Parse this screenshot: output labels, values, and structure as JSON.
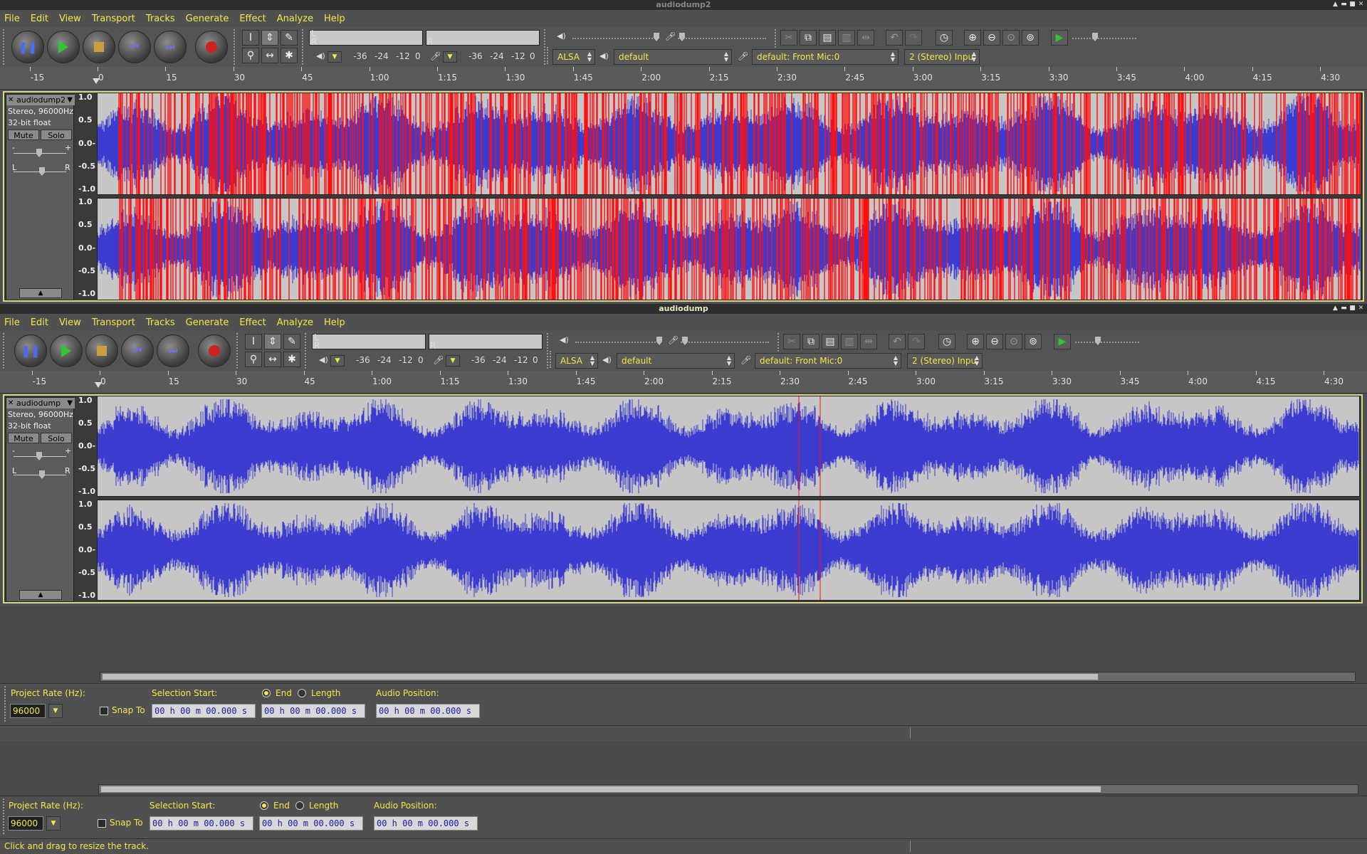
{
  "windows": [
    {
      "title": "audiodump2",
      "menu": [
        "File",
        "Edit",
        "View",
        "Transport",
        "Tracks",
        "Generate",
        "Effect",
        "Analyze",
        "Help"
      ],
      "meter_scale": [
        "-36",
        "-24",
        "-12",
        "0"
      ],
      "meter_scale_play": [
        "-36",
        "-24",
        "-12",
        "0"
      ],
      "meter_lr": {
        "l": "L",
        "r": "R"
      },
      "host": "ALSA",
      "output_device": "default",
      "input_device": "default: Front Mic:0",
      "channels": "2 (Stereo) Inpu",
      "ruler": [
        "-15",
        "0",
        "15",
        "30",
        "45",
        "1:00",
        "1:15",
        "1:30",
        "1:45",
        "2:00",
        "2:15",
        "2:30",
        "2:45",
        "3:00",
        "3:15",
        "3:30",
        "3:45",
        "4:00",
        "4:15",
        "4:30"
      ],
      "track": {
        "name": "audiodump2",
        "format": "Stereo, 96000Hz",
        "bitdepth": "32-bit float",
        "mute": "Mute",
        "solo": "Solo",
        "gain_minus": "-",
        "gain_plus": "+",
        "pan_l": "L",
        "pan_r": "R",
        "vscale": [
          "1.0",
          "0.5",
          "0.0-",
          "-0.5",
          "-1.0"
        ],
        "clipped": true
      }
    },
    {
      "title": "audiodump",
      "menu": [
        "File",
        "Edit",
        "View",
        "Transport",
        "Tracks",
        "Generate",
        "Effect",
        "Analyze",
        "Help"
      ],
      "meter_scale": [
        "-36",
        "-24",
        "-12",
        "0"
      ],
      "meter_scale_play": [
        "-36",
        "-24",
        "-12",
        "0"
      ],
      "meter_lr": {
        "l": "L",
        "r": "R"
      },
      "host": "ALSA",
      "output_device": "default",
      "input_device": "default: Front Mic:0",
      "channels": "2 (Stereo) Inpu",
      "ruler": [
        "-15",
        "0",
        "15",
        "30",
        "45",
        "1:00",
        "1:15",
        "1:30",
        "1:45",
        "2:00",
        "2:15",
        "2:30",
        "2:45",
        "3:00",
        "3:15",
        "3:30",
        "3:45",
        "4:00",
        "4:15",
        "4:30"
      ],
      "track": {
        "name": "audiodump",
        "format": "Stereo, 96000Hz",
        "bitdepth": "32-bit float",
        "mute": "Mute",
        "solo": "Solo",
        "gain_minus": "-",
        "gain_plus": "+",
        "pan_l": "L",
        "pan_r": "R",
        "vscale": [
          "1.0",
          "0.5",
          "0.0-",
          "-0.5",
          "-1.0"
        ],
        "clipped": false
      }
    }
  ],
  "selection_bars": [
    {
      "project_rate_label": "Project Rate (Hz):",
      "project_rate": "96000",
      "snap_to": "Snap To",
      "selection_start_label": "Selection Start:",
      "end_label": "End",
      "length_label": "Length",
      "audio_position_label": "Audio Position:",
      "selection_start": "00 h 00 m 00.000 s",
      "selection_end": "00 h 00 m 00.000 s",
      "audio_position": "00 h 00 m 00.000 s"
    },
    {
      "project_rate_label": "Project Rate (Hz):",
      "project_rate": "96000",
      "snap_to": "Snap To",
      "selection_start_label": "Selection Start:",
      "end_label": "End",
      "length_label": "Length",
      "audio_position_label": "Audio Position:",
      "selection_start": "00 h 00 m 00.000 s",
      "selection_end": "00 h 00 m 00.000 s",
      "audio_position": "00 h 00 m 00.000 s"
    }
  ],
  "status_text": "Click and drag to resize the track.",
  "colors": {
    "wave": "#3c3cd0",
    "clip": "#ff1010",
    "menu_text": "#f2e84a",
    "wave_bg": "#c6c6c6"
  }
}
